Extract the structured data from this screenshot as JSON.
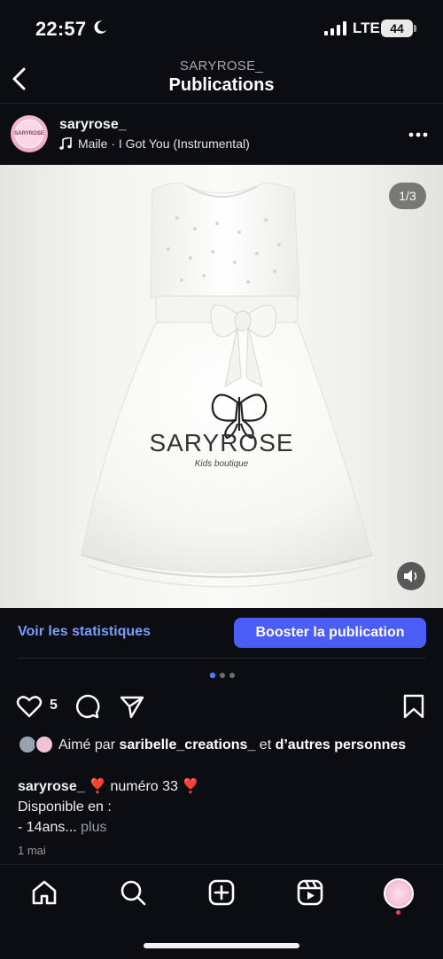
{
  "status_bar": {
    "time": "22:57",
    "network": "LTE",
    "battery": "44"
  },
  "header": {
    "account": "SARYROSE_",
    "title": "Publications"
  },
  "post": {
    "username": "saryrose_",
    "audio": "Maile · I Got You (Instrumental)",
    "avatar_text": "SARYROSE",
    "image_counter": "1/3",
    "brand_watermark": "SARYROSE",
    "brand_tagline": "Kids boutique"
  },
  "actions": {
    "stats_label": "Voir les statistiques",
    "boost_label": "Booster la publication",
    "like_count": "5"
  },
  "likes": {
    "prefix": "Aimé par ",
    "user": "saribelle_creations_",
    "middle": " et ",
    "suffix": "d’autres personnes"
  },
  "caption": {
    "username": "saryrose_",
    "line1": " ❣️ numéro 33 ❣️",
    "line2": "Disponible en :",
    "line3": "- 14ans...",
    "more": "plus"
  },
  "date": "1 mai",
  "icons": {
    "moon": "moon-icon",
    "signal": "signal-icon",
    "back": "chevron-left-icon",
    "music": "music-note-icon",
    "more": "more-horizontal-icon",
    "volume": "volume-icon",
    "heart": "heart-icon",
    "comment": "comment-icon",
    "share": "send-icon",
    "save": "bookmark-icon",
    "home": "home-icon",
    "search": "search-icon",
    "create": "add-square-icon",
    "reels": "reels-icon"
  },
  "colors": {
    "background": "#0b0d12",
    "link": "#7a9bff",
    "boost": "#4a5df5",
    "notification": "#ff3b4f"
  }
}
